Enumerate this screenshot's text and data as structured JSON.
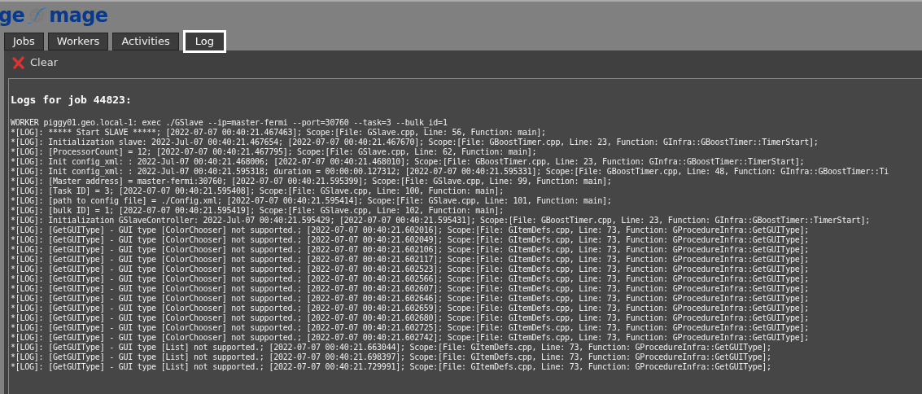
{
  "logo": {
    "left": "ge",
    "right": "mage"
  },
  "tabs": [
    {
      "label": "Jobs",
      "selected": false
    },
    {
      "label": "Workers",
      "selected": false
    },
    {
      "label": "Activities",
      "selected": false
    },
    {
      "label": "Log",
      "selected": true
    }
  ],
  "toolbar": {
    "clear_button": "Clear"
  },
  "log": {
    "title": "Logs for job 44823:",
    "lines": [
      "WORKER piggy01.geo.local-1: exec ./GSlave --ip=master-fermi --port=30760 --task=3 --bulk_id=1",
      "*[LOG]: ***** Start SLAVE *****; [2022-07-07 00:40:21.467463]; Scope:[File: GSlave.cpp, Line: 56, Function: main];",
      "*[LOG]: Initialization slave: 2022-Jul-07 00:40:21.467654; [2022-07-07 00:40:21.467670]; Scope:[File: GBoostTimer.cpp, Line: 23, Function: GInfra::GBoostTimer::TimerStart];",
      "*[LOG]: [ProcessorCount] = 12; [2022-07-07 00:40:21.467795]; Scope:[File: GSlave.cpp, Line: 62, Function: main];",
      "*[LOG]: Init config_xml: : 2022-Jul-07 00:40:21.468006; [2022-07-07 00:40:21.468010]; Scope:[File: GBoostTimer.cpp, Line: 23, Function: GInfra::GBoostTimer::TimerStart];",
      "*[LOG]: Init config_xml: : 2022-Jul-07 00:40:21.595318; duration = 00:00:00.127312; [2022-07-07 00:40:21.595331]; Scope:[File: GBoostTimer.cpp, Line: 48, Function: GInfra::GBoostTimer::Ti",
      "*[LOG]: [Master address] = master-fermi:30760; [2022-07-07 00:40:21.595399]; Scope:[File: GSlave.cpp, Line: 99, Function: main];",
      "*[LOG]: [Task ID] = 3; [2022-07-07 00:40:21.595408]; Scope:[File: GSlave.cpp, Line: 100, Function: main];",
      "*[LOG]: [path to config file] = ./Config.xml; [2022-07-07 00:40:21.595414]; Scope:[File: GSlave.cpp, Line: 101, Function: main];",
      "*[LOG]: [bulk ID] = 1; [2022-07-07 00:40:21.595419]; Scope:[File: GSlave.cpp, Line: 102, Function: main];",
      "*[LOG]: Initialization GSlaveController: 2022-Jul-07 00:40:21.595429; [2022-07-07 00:40:21.595431]; Scope:[File: GBoostTimer.cpp, Line: 23, Function: GInfra::GBoostTimer::TimerStart];",
      "*[LOG]: [GetGUIType] - GUI type [ColorChooser] not supported.; [2022-07-07 00:40:21.602016]; Scope:[File: GItemDefs.cpp, Line: 73, Function: GProcedureInfra::GetGUIType];",
      "*[LOG]: [GetGUIType] - GUI type [ColorChooser] not supported.; [2022-07-07 00:40:21.602049]; Scope:[File: GItemDefs.cpp, Line: 73, Function: GProcedureInfra::GetGUIType];",
      "*[LOG]: [GetGUIType] - GUI type [ColorChooser] not supported.; [2022-07-07 00:40:21.602106]; Scope:[File: GItemDefs.cpp, Line: 73, Function: GProcedureInfra::GetGUIType];",
      "*[LOG]: [GetGUIType] - GUI type [ColorChooser] not supported.; [2022-07-07 00:40:21.602117]; Scope:[File: GItemDefs.cpp, Line: 73, Function: GProcedureInfra::GetGUIType];",
      "*[LOG]: [GetGUIType] - GUI type [ColorChooser] not supported.; [2022-07-07 00:40:21.602523]; Scope:[File: GItemDefs.cpp, Line: 73, Function: GProcedureInfra::GetGUIType];",
      "*[LOG]: [GetGUIType] - GUI type [ColorChooser] not supported.; [2022-07-07 00:40:21.602566]; Scope:[File: GItemDefs.cpp, Line: 73, Function: GProcedureInfra::GetGUIType];",
      "*[LOG]: [GetGUIType] - GUI type [ColorChooser] not supported.; [2022-07-07 00:40:21.602607]; Scope:[File: GItemDefs.cpp, Line: 73, Function: GProcedureInfra::GetGUIType];",
      "*[LOG]: [GetGUIType] - GUI type [ColorChooser] not supported.; [2022-07-07 00:40:21.602646]; Scope:[File: GItemDefs.cpp, Line: 73, Function: GProcedureInfra::GetGUIType];",
      "*[LOG]: [GetGUIType] - GUI type [ColorChooser] not supported.; [2022-07-07 00:40:21.602659]; Scope:[File: GItemDefs.cpp, Line: 73, Function: GProcedureInfra::GetGUIType];",
      "*[LOG]: [GetGUIType] - GUI type [ColorChooser] not supported.; [2022-07-07 00:40:21.602680]; Scope:[File: GItemDefs.cpp, Line: 73, Function: GProcedureInfra::GetGUIType];",
      "*[LOG]: [GetGUIType] - GUI type [ColorChooser] not supported.; [2022-07-07 00:40:21.602725]; Scope:[File: GItemDefs.cpp, Line: 73, Function: GProcedureInfra::GetGUIType];",
      "*[LOG]: [GetGUIType] - GUI type [ColorChooser] not supported.; [2022-07-07 00:40:21.602742]; Scope:[File: GItemDefs.cpp, Line: 73, Function: GProcedureInfra::GetGUIType];",
      "*[LOG]: [GetGUIType] - GUI type [List] not supported.; [2022-07-07 00:40:21.663044]; Scope:[File: GItemDefs.cpp, Line: 73, Function: GProcedureInfra::GetGUIType];",
      "*[LOG]: [GetGUIType] - GUI type [List] not supported.; [2022-07-07 00:40:21.698397]; Scope:[File: GItemDefs.cpp, Line: 73, Function: GProcedureInfra::GetGUIType];",
      "*[LOG]: [GetGUIType] - GUI type [List] not supported.; [2022-07-07 00:40:21.729991]; Scope:[File: GItemDefs.cpp, Line: 73, Function: GProcedureInfra::GetGUIType];"
    ]
  }
}
